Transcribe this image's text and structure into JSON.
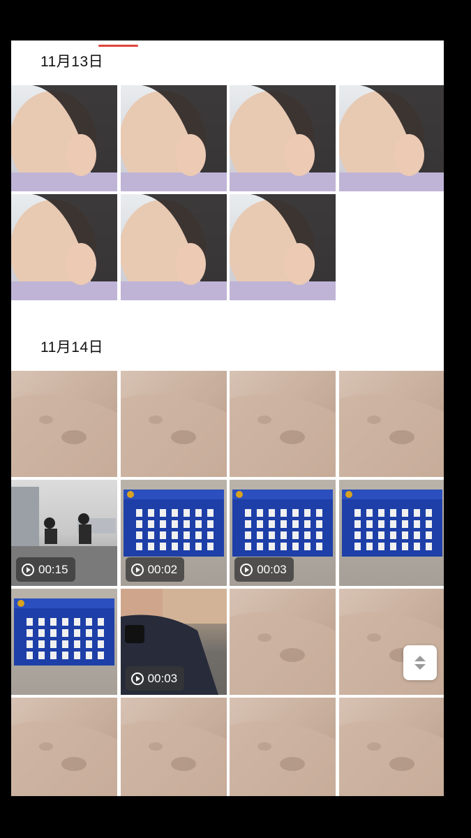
{
  "gallery": {
    "sections": [
      {
        "date": "11月13日",
        "items": [
          {
            "kind": "selfie"
          },
          {
            "kind": "selfie"
          },
          {
            "kind": "selfie"
          },
          {
            "kind": "selfie"
          },
          {
            "kind": "selfie"
          },
          {
            "kind": "selfie"
          },
          {
            "kind": "selfie"
          }
        ]
      },
      {
        "date": "11月14日",
        "items": [
          {
            "kind": "skin"
          },
          {
            "kind": "skin"
          },
          {
            "kind": "skin"
          },
          {
            "kind": "skin"
          },
          {
            "kind": "room",
            "duration": "00:15"
          },
          {
            "kind": "board",
            "duration": "00:02"
          },
          {
            "kind": "board",
            "duration": "00:03"
          },
          {
            "kind": "board"
          },
          {
            "kind": "board"
          },
          {
            "kind": "police",
            "duration": "00:03"
          },
          {
            "kind": "skin"
          },
          {
            "kind": "skin"
          },
          {
            "kind": "skin"
          },
          {
            "kind": "skin"
          },
          {
            "kind": "skin"
          },
          {
            "kind": "skin"
          }
        ]
      }
    ]
  },
  "colors": {
    "accent": "#e0463a",
    "background": "#ffffff",
    "frame": "#000000",
    "board_blue": "#1e3fa8"
  },
  "icons": {
    "play": "play-circle-icon",
    "scroll": "scroll-handle-icon"
  }
}
